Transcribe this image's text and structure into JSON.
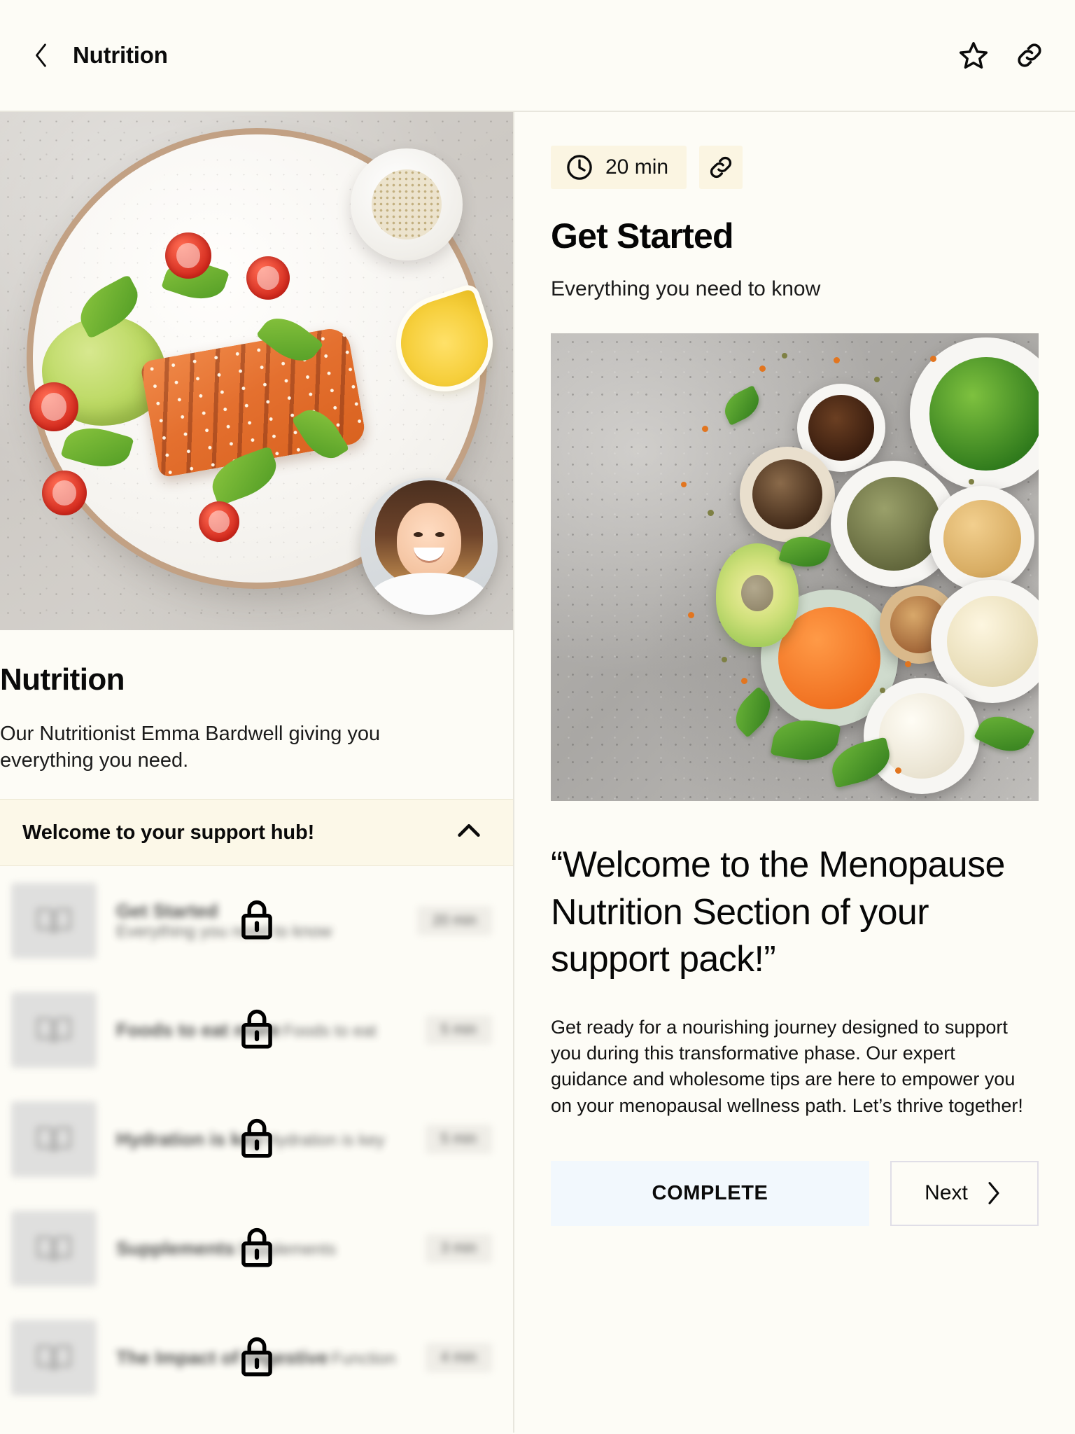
{
  "appbar": {
    "back_icon": "chevron-left-icon",
    "title": "Nutrition",
    "favorite_icon": "star-icon",
    "share_icon": "link-icon"
  },
  "left": {
    "hero_icon": "salmon-salad-photo",
    "presenter_avatar": "presenter-avatar",
    "title": "Nutrition",
    "description": "Our Nutritionist Emma Bardwell giving you everything you need.",
    "accordion": {
      "title": "Welcome to your support hub!",
      "chevron_icon": "chevron-up-icon",
      "expanded": true
    },
    "lessons": [
      {
        "icon": "book-icon",
        "name": "Get Started",
        "subtitle": "Everything you need to know",
        "duration": "20 min",
        "locked": true,
        "lock_icon": "lock-icon"
      },
      {
        "icon": "book-icon",
        "name": "Foods to eat more",
        "subtitle": "Foods to eat",
        "duration": "5 min",
        "locked": true,
        "lock_icon": "lock-icon"
      },
      {
        "icon": "book-icon",
        "name": "Hydration is key",
        "subtitle": "Hydration is key",
        "duration": "5 min",
        "locked": true,
        "lock_icon": "lock-icon"
      },
      {
        "icon": "book-icon",
        "name": "Supplements",
        "subtitle": "Supplements",
        "duration": "3 min",
        "locked": true,
        "lock_icon": "lock-icon"
      },
      {
        "icon": "book-icon",
        "name": "The Impact of Digestive",
        "subtitle": "Function",
        "duration": "4 min",
        "locked": true,
        "lock_icon": "lock-icon"
      }
    ]
  },
  "right": {
    "duration_icon": "clock-icon",
    "duration": "20 min",
    "share_icon": "link-icon",
    "heading": "Get Started",
    "subheading": "Everything you need to know",
    "image_icon": "plant-protein-bowls-photo",
    "quote": "“Welcome to the Menopause Nutrition Section of your support pack!”",
    "paragraph": "Get ready for a nourishing journey designed to support you during this transformative phase. Our expert guidance and wholesome tips are here to empower you on your menopausal wellness path. Let’s thrive together!",
    "complete_label": "COMPLETE",
    "next_label": "Next",
    "next_icon": "chevron-right-icon"
  },
  "colors": {
    "page_background": "#fdfcf6",
    "accordion_background": "#fcf8e8",
    "chip_background": "#fbf5e2",
    "complete_background": "#f2f8fd",
    "next_border": "#e0dee7",
    "text_primary": "#0a0a0a"
  }
}
